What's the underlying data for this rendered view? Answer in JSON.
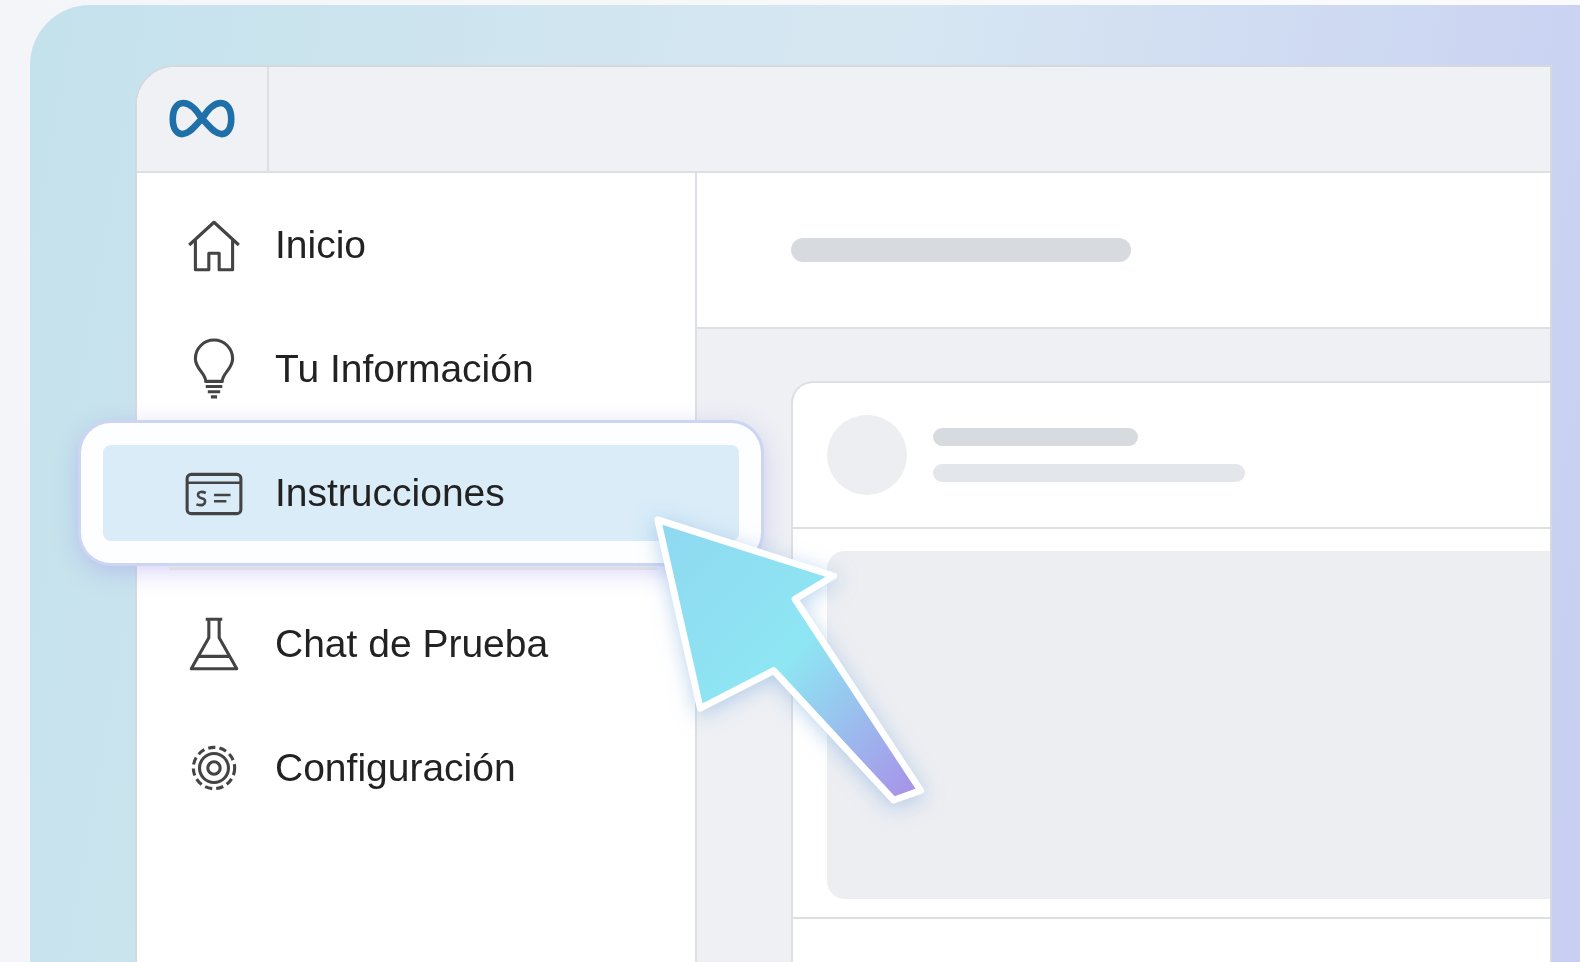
{
  "sidebar": {
    "groups": [
      [
        {
          "label": "Inicio",
          "selected": false
        },
        {
          "label": "Tu Información",
          "selected": false
        },
        {
          "label": "Instrucciones",
          "selected": true
        }
      ],
      [
        {
          "label": "Chat de Prueba",
          "selected": false
        },
        {
          "label": "Configuración",
          "selected": false
        }
      ]
    ]
  }
}
